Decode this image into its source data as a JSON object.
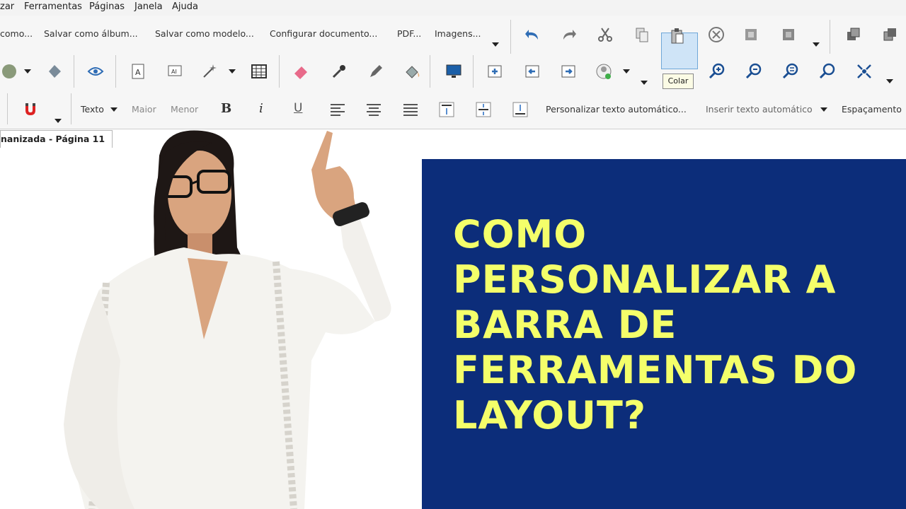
{
  "menubar": {
    "items": [
      "zar",
      "Ferramentas",
      "Páginas",
      "Janela",
      "Ajuda"
    ]
  },
  "toolbar1": {
    "items": [
      "como...",
      "Salvar como álbum...",
      "Salvar como modelo...",
      "Configurar documento...",
      "PDF...",
      "Imagens..."
    ]
  },
  "toolbar3": {
    "texto": "Texto",
    "maior": "Maior",
    "menor": "Menor",
    "bold": "B",
    "italic": "i",
    "underline": "U",
    "personalizar": "Personalizar texto automático...",
    "inserir": "Inserir texto automático",
    "espacamento": "Espaçamento"
  },
  "tooltip": "Colar",
  "tab": "nanizada - Página 11",
  "headline": [
    "COMO",
    "PERSONALIZAR A",
    "BARRA DE",
    "FERRAMENTAS DO",
    "LAYOUT?"
  ],
  "colors": {
    "banner": "#0c2d7a",
    "headline": "#f4ff6a"
  },
  "icons": [
    "undo-icon",
    "redo-icon",
    "cut-icon",
    "copy-icon",
    "paste-icon",
    "cancel-icon",
    "puzzle-icon",
    "puzzle-icon-2",
    "layers-icon",
    "layers-icon-2",
    "palette-icon",
    "eye-icon",
    "text-frame-icon",
    "image-frame-icon",
    "magic-wand-icon",
    "table-icon",
    "eraser-icon",
    "eyedropper-icon",
    "pen-icon",
    "fill-icon",
    "monitor-icon",
    "add-page-icon",
    "prev-page-icon",
    "next-page-icon",
    "user-icon",
    "zoom-in-icon",
    "zoom-out-icon",
    "zoom-fit-icon",
    "zoom-icon",
    "fullscreen-icon",
    "magnet-icon",
    "align-left-icon",
    "align-center-icon",
    "align-right-icon",
    "valign-top-icon",
    "valign-middle-icon",
    "valign-bottom-icon"
  ]
}
